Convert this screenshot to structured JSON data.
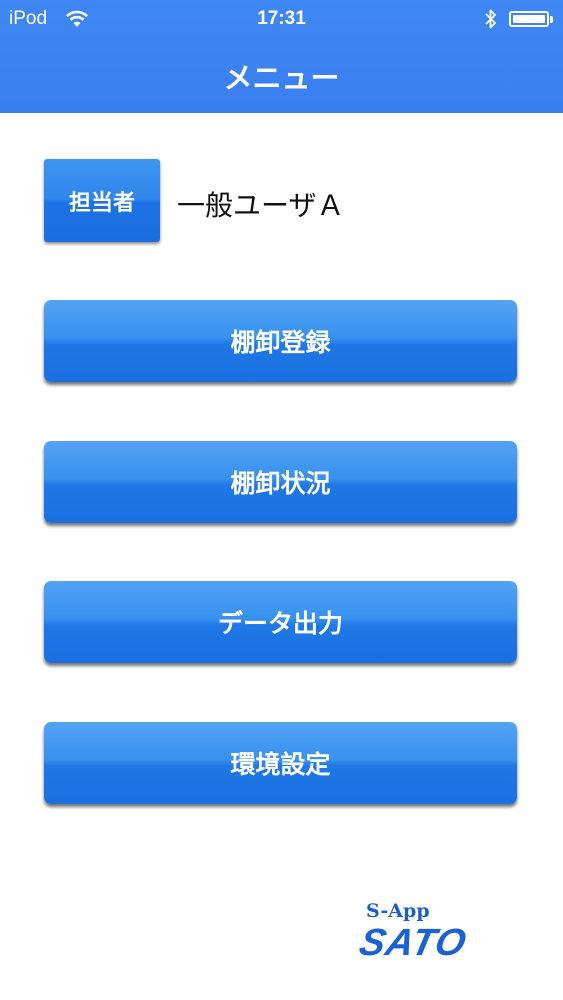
{
  "status_bar": {
    "carrier": "iPod",
    "time": "17:31"
  },
  "nav": {
    "title": "メニュー"
  },
  "user": {
    "button_label": "担当者",
    "name": "一般ユーザＡ"
  },
  "menu": {
    "items": [
      {
        "label": "棚卸登録"
      },
      {
        "label": "棚卸状況"
      },
      {
        "label": "データ出力"
      },
      {
        "label": "環境設定"
      }
    ]
  },
  "logo": {
    "line1": "S-App",
    "line2": "SATO"
  },
  "colors": {
    "header": "#3a7ef0",
    "button": "#2f86ec"
  }
}
